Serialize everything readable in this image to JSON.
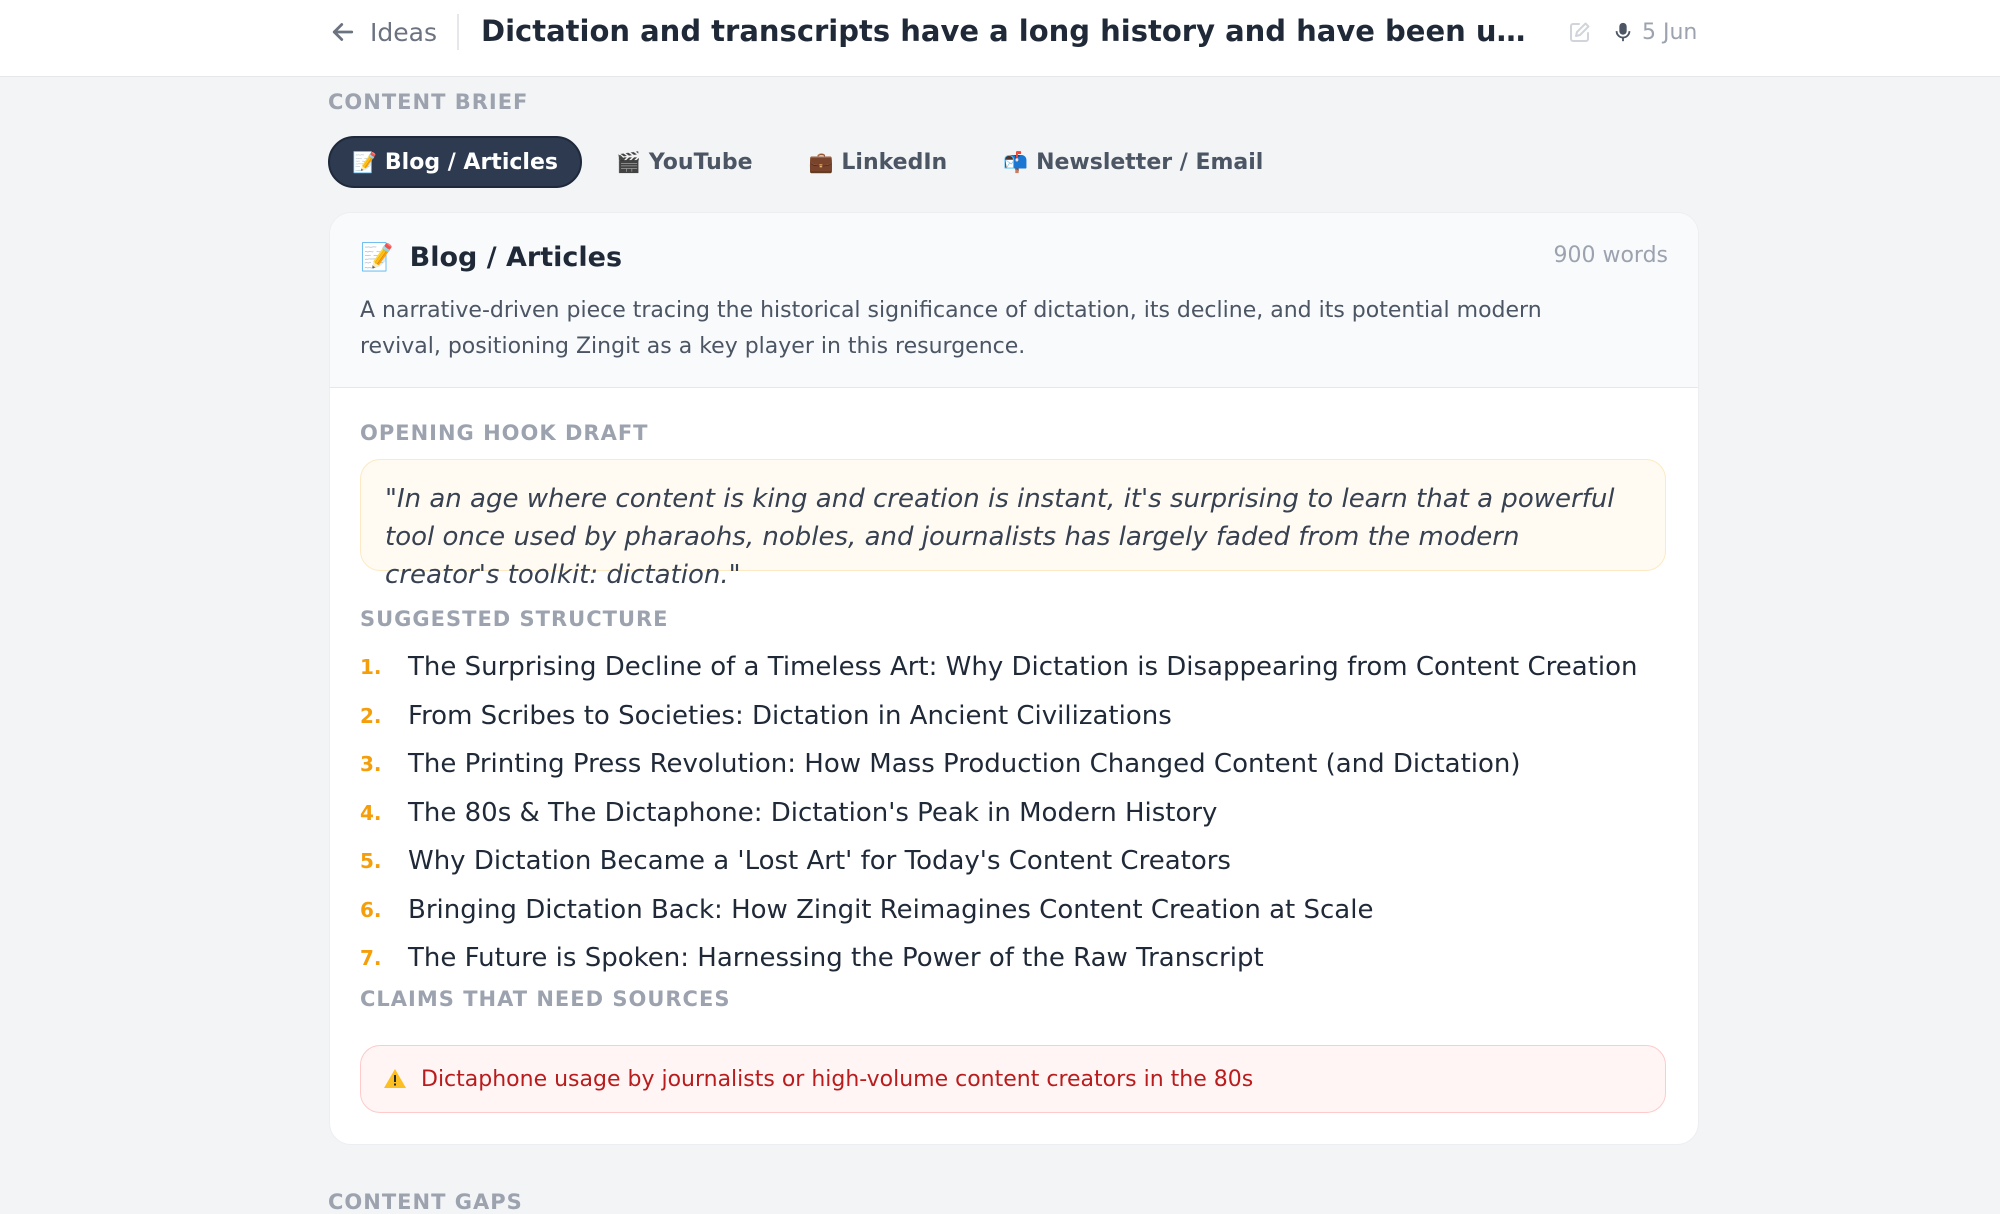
{
  "header": {
    "back_label": "Ideas",
    "title": "Dictation and transcripts have a long history and have been used a lot of different ways over the centuries",
    "date_icon": "microphone-icon",
    "date": "5 Jun"
  },
  "content_brief": {
    "label": "CONTENT BRIEF",
    "tabs": [
      {
        "emoji": "📝",
        "label": "Blog / Articles",
        "active": true
      },
      {
        "emoji": "🎬",
        "label": "YouTube",
        "active": false
      },
      {
        "emoji": "💼",
        "label": "LinkedIn",
        "active": false
      },
      {
        "emoji": "📬",
        "label": "Newsletter / Email",
        "active": false
      }
    ]
  },
  "card": {
    "emoji": "📝",
    "title": "Blog / Articles",
    "word_count": "900 words",
    "description": "A narrative-driven piece tracing the historical significance of dictation, its decline, and its potential modern revival, positioning Zingit as a key player in this resurgence.",
    "hook_label": "OPENING HOOK DRAFT",
    "hook": "\"In an age where content is king and creation is instant, it's surprising to learn that a powerful tool once used by pharaohs, nobles, and journalists has largely faded from the modern creator's toolkit: dictation.\"",
    "structure_label": "SUGGESTED STRUCTURE",
    "structure": [
      {
        "num": "1.",
        "text": "The Surprising Decline of a Timeless Art: Why Dictation is Disappearing from Content Creation"
      },
      {
        "num": "2.",
        "text": "From Scribes to Societies: Dictation in Ancient Civilizations"
      },
      {
        "num": "3.",
        "text": "The Printing Press Revolution: How Mass Production Changed Content (and Dictation)"
      },
      {
        "num": "4.",
        "text": "The 80s & The Dictaphone: Dictation's Peak in Modern History"
      },
      {
        "num": "5.",
        "text": "Why Dictation Became a 'Lost Art' for Today's Content Creators"
      },
      {
        "num": "6.",
        "text": "Bringing Dictation Back: How Zingit Reimagines Content Creation at Scale"
      },
      {
        "num": "7.",
        "text": "The Future is Spoken: Harnessing the Power of the Raw Transcript"
      }
    ],
    "claims_label": "CLAIMS THAT NEED SOURCES",
    "claims": [
      {
        "icon": "warning-icon",
        "text": "Dictaphone usage by journalists or high-volume content creators in the 80s"
      }
    ]
  },
  "content_gaps": {
    "label": "CONTENT GAPS"
  },
  "colors": {
    "active_tab": "#2d3a4f",
    "accent_number": "#f59e0b",
    "claim_text": "#b91c1c",
    "hook_bg": "#fffbf2"
  }
}
